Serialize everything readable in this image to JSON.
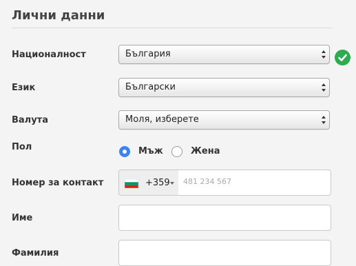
{
  "section": {
    "title": "Лични данни"
  },
  "fields": {
    "nationality": {
      "label": "Националност",
      "value": "България",
      "valid": true
    },
    "language": {
      "label": "Език",
      "value": "Български"
    },
    "currency": {
      "label": "Валута",
      "value": "Моля, изберете"
    },
    "gender": {
      "label": "Пол",
      "options": [
        "Мъж",
        "Жена"
      ],
      "selected": "Мъж"
    },
    "phone": {
      "label": "Номер за контакт",
      "country_code": "+359",
      "placeholder": "481 234 567",
      "flag": "bulgaria-flag"
    },
    "first_name": {
      "label": "Име",
      "value": ""
    },
    "last_name": {
      "label": "Фамилия",
      "value": ""
    }
  },
  "colors": {
    "accent": "#3b82f6",
    "valid": "#2eaa4f"
  }
}
